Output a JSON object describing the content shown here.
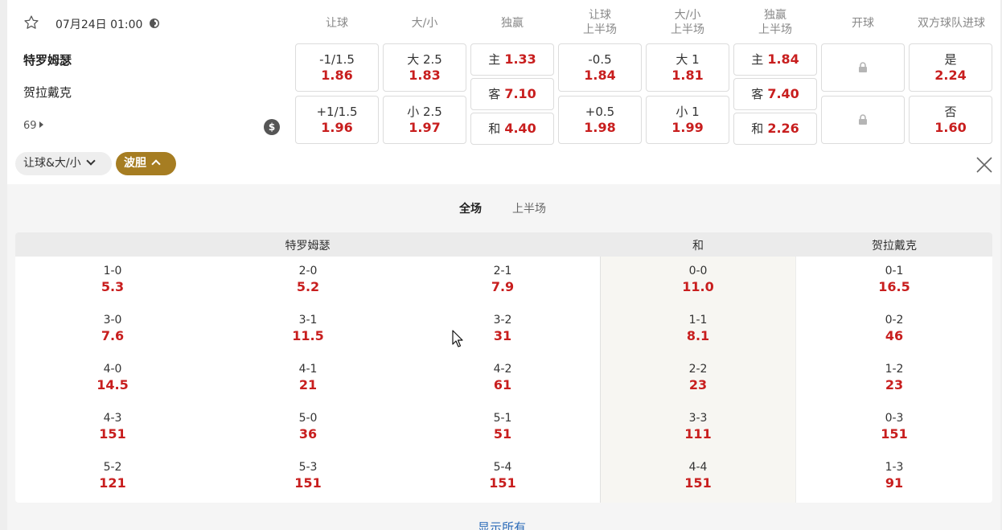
{
  "match": {
    "datetime": "07月24日 01:00",
    "home_team": "特罗姆瑟",
    "away_team": "贺拉戴克",
    "more_markets_count": "69",
    "cashout_symbol": "$"
  },
  "market_headers": [
    "让球",
    "大/小",
    "独赢",
    "让球\n上半场",
    "大/小\n上半场",
    "独赢\n上半场",
    "开球",
    "双方球队进球"
  ],
  "handicap": {
    "home": {
      "line": "-1/1.5",
      "odds": "1.86"
    },
    "away": {
      "line": "+1/1.5",
      "odds": "1.96"
    }
  },
  "over_under": {
    "over": {
      "line": "大 2.5",
      "odds": "1.83"
    },
    "under": {
      "line": "小 2.5",
      "odds": "1.97"
    }
  },
  "moneyline": {
    "home": {
      "label": "主",
      "odds": "1.33"
    },
    "away": {
      "label": "客",
      "odds": "7.10"
    },
    "draw": {
      "label": "和",
      "odds": "4.40"
    }
  },
  "handicap_1h": {
    "home": {
      "line": "-0.5",
      "odds": "1.84"
    },
    "away": {
      "line": "+0.5",
      "odds": "1.98"
    }
  },
  "over_under_1h": {
    "over": {
      "line": "大 1",
      "odds": "1.81"
    },
    "under": {
      "line": "小 1",
      "odds": "1.99"
    }
  },
  "moneyline_1h": {
    "home": {
      "label": "主",
      "odds": "1.84"
    },
    "away": {
      "label": "客",
      "odds": "7.40"
    },
    "draw": {
      "label": "和",
      "odds": "2.26"
    }
  },
  "btts": {
    "yes": {
      "label": "是",
      "odds": "2.24"
    },
    "no": {
      "label": "否",
      "odds": "1.60"
    }
  },
  "filters": {
    "handicap_ou": "让球&大/小",
    "correct_score": "波胆"
  },
  "period_tabs": {
    "full_time": "全场",
    "first_half": "上半场"
  },
  "correct_score": {
    "home_header": "特罗姆瑟",
    "draw_header": "和",
    "away_header": "贺拉戴克",
    "home": [
      [
        {
          "score": "1-0",
          "odds": "5.3"
        },
        {
          "score": "2-0",
          "odds": "5.2"
        },
        {
          "score": "2-1",
          "odds": "7.9"
        }
      ],
      [
        {
          "score": "3-0",
          "odds": "7.6"
        },
        {
          "score": "3-1",
          "odds": "11.5"
        },
        {
          "score": "3-2",
          "odds": "31"
        }
      ],
      [
        {
          "score": "4-0",
          "odds": "14.5"
        },
        {
          "score": "4-1",
          "odds": "21"
        },
        {
          "score": "4-2",
          "odds": "61"
        }
      ],
      [
        {
          "score": "4-3",
          "odds": "151"
        },
        {
          "score": "5-0",
          "odds": "36"
        },
        {
          "score": "5-1",
          "odds": "51"
        }
      ],
      [
        {
          "score": "5-2",
          "odds": "121"
        },
        {
          "score": "5-3",
          "odds": "151"
        },
        {
          "score": "5-4",
          "odds": "151"
        }
      ]
    ],
    "draw": [
      {
        "score": "0-0",
        "odds": "11.0"
      },
      {
        "score": "1-1",
        "odds": "8.1"
      },
      {
        "score": "2-2",
        "odds": "23"
      },
      {
        "score": "3-3",
        "odds": "111"
      },
      {
        "score": "4-4",
        "odds": "151"
      }
    ],
    "away": [
      {
        "score": "0-1",
        "odds": "16.5"
      },
      {
        "score": "0-2",
        "odds": "46"
      },
      {
        "score": "1-2",
        "odds": "23"
      },
      {
        "score": "0-3",
        "odds": "151"
      },
      {
        "score": "1-3",
        "odds": "91"
      }
    ]
  },
  "show_all": "显示所有",
  "colors": {
    "odds_red": "#c81e1e",
    "active_filter_gold": "#a67d22",
    "link_blue": "#2a6ab8"
  },
  "icons": [
    "star-icon",
    "live-icon",
    "cashout-icon",
    "lock-icon",
    "close-icon",
    "chevron-down-icon",
    "chevron-up-icon",
    "mouse-cursor-icon"
  ]
}
